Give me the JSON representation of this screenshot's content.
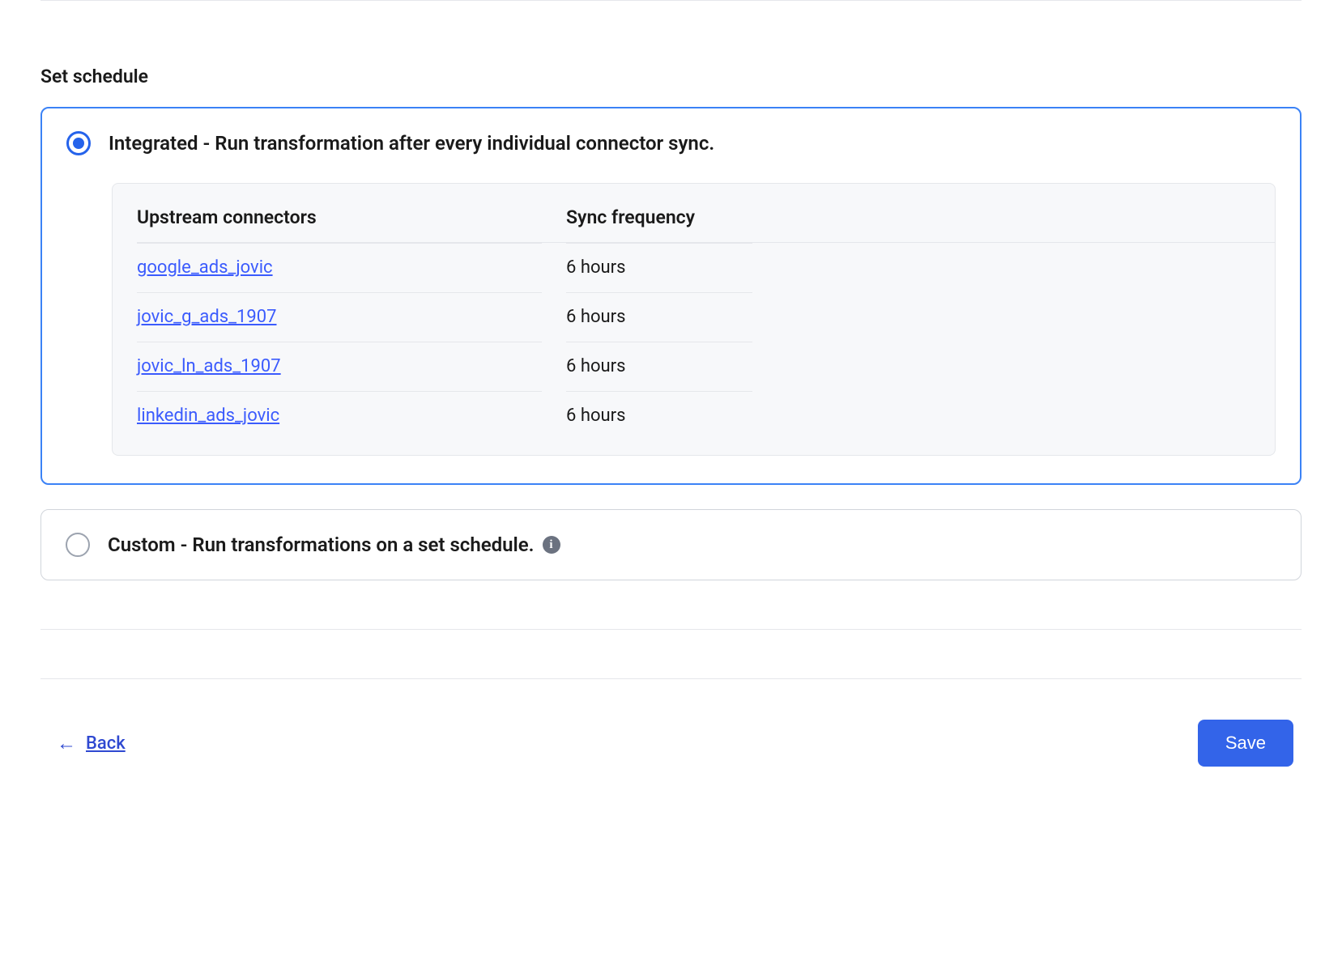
{
  "section_title": "Set schedule",
  "options": {
    "integrated": {
      "label": "Integrated - Run transformation after every individual connector sync.",
      "selected": true
    },
    "custom": {
      "label": "Custom - Run transformations on a set schedule.",
      "selected": false
    }
  },
  "table": {
    "headers": {
      "connectors": "Upstream connectors",
      "frequency": "Sync frequency"
    },
    "rows": [
      {
        "name": "google_ads_jovic",
        "frequency": "6 hours"
      },
      {
        "name": "jovic_g_ads_1907",
        "frequency": "6 hours"
      },
      {
        "name": "jovic_ln_ads_1907",
        "frequency": "6 hours"
      },
      {
        "name": "linkedin_ads_jovic",
        "frequency": "6 hours"
      }
    ]
  },
  "footer": {
    "back_label": "Back",
    "save_label": "Save"
  }
}
